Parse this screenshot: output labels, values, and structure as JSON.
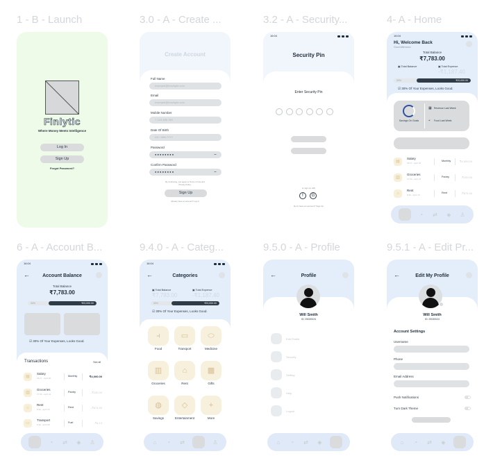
{
  "frames": {
    "launch": {
      "title": "1 - B - Launch",
      "app_name": "Finlytic",
      "tagline": "Where Money Meets Intelligence",
      "login": "Log In",
      "signup": "Sign Up",
      "forgot": "Forgot Password?"
    },
    "create": {
      "title": "3.0 - A - Create ...",
      "heading": "Create Account",
      "fields": [
        {
          "label": "Full Name",
          "placeholder": "example@example.com"
        },
        {
          "label": "Email",
          "placeholder": "example@example.com"
        },
        {
          "label": "Mobile Number",
          "placeholder": "+ 123 456 789"
        },
        {
          "label": "Date Of Birth",
          "placeholder": "DD / MM /YYY"
        },
        {
          "label": "Password",
          "placeholder": "● ● ● ● ● ● ● ●"
        },
        {
          "label": "Confirm Password",
          "placeholder": "● ● ● ● ● ● ● ●"
        }
      ],
      "terms": "By continuing, you agree to Terms of Use and Privacy Policy.",
      "signup": "Sign Up",
      "login_hint": "Already have an account? Log In"
    },
    "pin": {
      "title": "3.2 - A - Security...",
      "time": "16:04",
      "heading": "Security Pin",
      "subheading": "Enter Security Pin",
      "or_text": "or sign up with",
      "signup_hint": "Don't have an account? Sign Up"
    },
    "home": {
      "title": "4- A - Home",
      "time": "16:04",
      "greeting": "Hi, Welcome Back",
      "sub_greeting": "Good Afternoon",
      "total_balance_label": "Total Balance",
      "total_balance": "₹7,783.00",
      "left_label": "Total Balance",
      "right_label": "Total Expense",
      "expense": "-₹1,187.40",
      "progress_pct": "30%",
      "progress_value": 0.3,
      "goal": "₹20,000.00",
      "note": "30% Of Your Expenses, Looks Good.",
      "savings_label": "Savings On Goals",
      "revenue_label": "Revenue Last Week",
      "food_label": "Food Last Week",
      "transactions": [
        {
          "name": "Salary",
          "time": "18:27 - April 30",
          "cat": "Monthly",
          "amount": "₹4,000.00"
        },
        {
          "name": "Groceries",
          "time": "17:00 - April 24",
          "cat": "Pantry",
          "amount": "-₹100.00"
        },
        {
          "name": "Rent",
          "time": "8:30 - April 15",
          "cat": "Rent",
          "amount": "-₹674.40"
        }
      ]
    },
    "account": {
      "title": "6 - A - Account B...",
      "time": "16:04",
      "heading": "Account Balance",
      "total_balance_label": "Total Balance",
      "total_balance": "₹7,783.00",
      "progress_pct": "30%",
      "progress_value": 0.3,
      "goal": "₹20,000.00",
      "note": "30% Of Your Expenses, Looks Good.",
      "transactions_title": "Transactions",
      "see_all": "See all",
      "transactions": [
        {
          "name": "Salary",
          "time": "18:27 - April 30",
          "cat": "Monthly",
          "amount": "₹4,000.00",
          "strong": true
        },
        {
          "name": "Groceries",
          "time": "17:00 - April 24",
          "cat": "Pantry",
          "amount": "-₹100.00"
        },
        {
          "name": "Rent",
          "time": "8:30 - April 15",
          "cat": "Rent",
          "amount": "-₹674.40"
        },
        {
          "name": "Transport",
          "time": "9:30 - April 08",
          "cat": "Fuel",
          "amount": "-₹4.13"
        }
      ]
    },
    "categories": {
      "title": "9.4.0 - A - Categ...",
      "time": "16:04",
      "heading": "Categories",
      "left_label": "Total Balance",
      "right_label": "Total Expense",
      "total_balance": "₹7,783.00",
      "expense": "-₹1,187.40",
      "progress_pct": "30%",
      "progress_value": 0.3,
      "goal": "₹20,000.00",
      "note": "30% Of Your Expenses, Looks Good.",
      "tiles": [
        "Food",
        "Transport",
        "Medicine",
        "Groceries",
        "Rent",
        "Gifts",
        "Savings",
        "Entertainment",
        "More"
      ]
    },
    "profile": {
      "title": "9.5.0 - A - Profile",
      "heading": "Profile",
      "name": "Will Smith",
      "id": "ID: 25030024",
      "menu": [
        "Edit Profile",
        "Security",
        "Setting",
        "Help",
        "Logout"
      ]
    },
    "edit": {
      "title": "9.5.1 - A - Edit Pr...",
      "heading": "Edit My Profile",
      "name": "Will Smith",
      "id": "ID: 25030024",
      "section": "Account Settings",
      "fields": [
        "Username",
        "Phone",
        "Email Address"
      ],
      "push": "Push Notifications",
      "dark": "Turn Dark Theme"
    }
  },
  "colors": {
    "launch_bg": "#effbe9",
    "tile_bg": "#f7f0dc",
    "nav_bg": "#dfe9f7"
  }
}
